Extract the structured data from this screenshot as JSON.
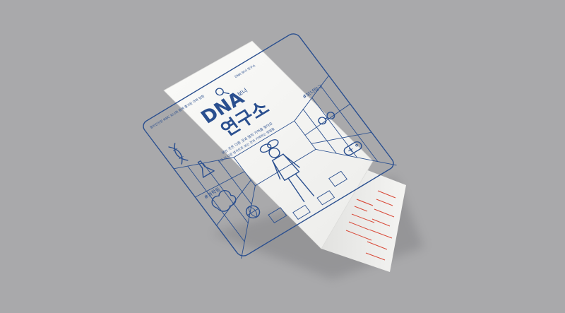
{
  "brochure": {
    "title_latin": "DNA",
    "title_small": "보너",
    "title_korean": "연구소",
    "tag_left": "#과학동",
    "tag_right": "#보너탐구",
    "subtitle": "보는 곳은 다른 곳과 달라 기억을 찾아요",
    "body_line_1": "조금 더 다른 방식으로 보는 것과 기억하는 방법을",
    "edge_text_left": "흥미진진한 MBC 보너와 함께 즐거운 과학 탐험",
    "edge_text_right": "DNA 보너 연구소",
    "accent_ink": "#2a4f8f",
    "accent_inner": "#d94b3a",
    "paper": "#f7f7f5"
  },
  "icons": [
    "dna-icon",
    "magnifier-icon",
    "flask-icon",
    "glasses-icon",
    "basketball-icon",
    "gamepad-icon",
    "brain-icon",
    "person-figure"
  ]
}
